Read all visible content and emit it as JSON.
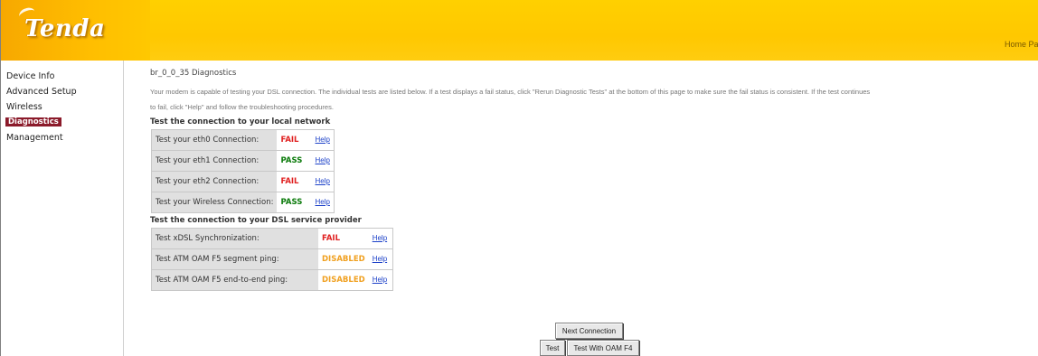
{
  "header": {
    "logo_text": "Tenda",
    "home_link": "Home Page"
  },
  "sidebar": {
    "items": [
      {
        "label": "Device Info"
      },
      {
        "label": "Advanced Setup"
      },
      {
        "label": "Wireless"
      },
      {
        "label": "Diagnostics",
        "active": true
      },
      {
        "label": "Management"
      }
    ]
  },
  "main": {
    "title": "br_0_0_35 Diagnostics",
    "description_line1": "Your modem is capable of testing your DSL connection. The individual tests are listed below. If a test displays a fail status, click \"Rerun Diagnostic Tests\" at the bottom of this page to make sure the fail status is consistent. If the test continues",
    "description_line2": "to fail, click \"Help\" and follow the troubleshooting procedures.",
    "local_heading": "Test the connection to your local network",
    "local_tests": [
      {
        "label": "Test your eth0 Connection:",
        "result": "FAIL",
        "help": "Help"
      },
      {
        "label": "Test your eth1 Connection:",
        "result": "PASS",
        "help": "Help"
      },
      {
        "label": "Test your eth2 Connection:",
        "result": "FAIL",
        "help": "Help"
      },
      {
        "label": "Test your Wireless Connection:",
        "result": "PASS",
        "help": "Help"
      }
    ],
    "dsl_heading": "Test the connection to your DSL service provider",
    "dsl_tests": [
      {
        "label": "Test xDSL Synchronization:",
        "result": "FAIL",
        "help": "Help"
      },
      {
        "label": "Test ATM OAM F5 segment ping:",
        "result": "DISABLED",
        "help": "Help"
      },
      {
        "label": "Test ATM OAM F5 end-to-end ping:",
        "result": "DISABLED",
        "help": "Help"
      }
    ]
  },
  "buttons": {
    "next_connection": "Next Connection",
    "test": "Test",
    "test_with_oam": "Test With OAM F4"
  },
  "colors": {
    "header_yellow": "#ffcc00",
    "active_nav": "#8b1a2a",
    "fail": "#e02020",
    "pass": "#0a7a0a",
    "disabled": "#f0a020",
    "link": "#1a3fc8"
  }
}
